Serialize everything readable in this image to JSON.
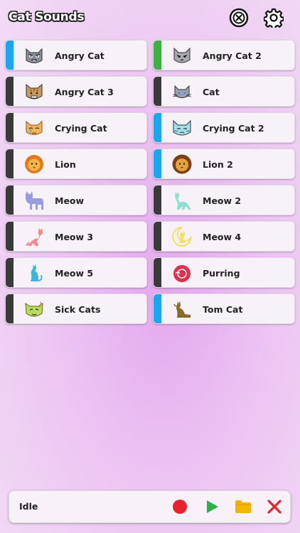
{
  "header": {
    "title": "Cat Sounds",
    "stop_all_icon": "stop-circle-icon",
    "settings_icon": "gear-icon"
  },
  "sounds": [
    {
      "label": "Angry Cat",
      "accent": "#1aa7ec",
      "icon": "angry-cat-face-icon"
    },
    {
      "label": "Angry Cat 2",
      "accent": "#3cb043",
      "icon": "angry-cat-face-2-icon"
    },
    {
      "label": "Angry Cat 3",
      "accent": "#3a3a3a",
      "icon": "tabby-cat-face-icon"
    },
    {
      "label": "Cat",
      "accent": "#3a3a3a",
      "icon": "grey-cat-face-icon"
    },
    {
      "label": "Crying Cat",
      "accent": "#3a3a3a",
      "icon": "crying-cat-face-icon"
    },
    {
      "label": "Crying Cat 2",
      "accent": "#1aa7ec",
      "icon": "crying-cat-face-2-icon"
    },
    {
      "label": "Lion",
      "accent": "#3a3a3a",
      "icon": "lion-face-icon"
    },
    {
      "label": "Lion 2",
      "accent": "#1aa7ec",
      "icon": "lion-face-2-icon"
    },
    {
      "label": "Meow",
      "accent": "#3a3a3a",
      "icon": "cat-silhouette-icon"
    },
    {
      "label": "Meow 2",
      "accent": "#3a3a3a",
      "icon": "cat-silhouette-2-icon"
    },
    {
      "label": "Meow 3",
      "accent": "#3a3a3a",
      "icon": "cat-silhouette-3-icon"
    },
    {
      "label": "Meow 4",
      "accent": "#3a3a3a",
      "icon": "cat-moon-icon"
    },
    {
      "label": "Meow 5",
      "accent": "#3a3a3a",
      "icon": "cat-sitting-icon"
    },
    {
      "label": "Purring",
      "accent": "#3a3a3a",
      "icon": "cat-curled-icon"
    },
    {
      "label": "Sick Cats",
      "accent": "#3a3a3a",
      "icon": "sick-cat-face-icon"
    },
    {
      "label": "Tom Cat",
      "accent": "#1aa7ec",
      "icon": "cat-sitting-brown-icon"
    }
  ],
  "player": {
    "status": "Idle",
    "record_icon": "record-icon",
    "play_icon": "play-icon",
    "folder_icon": "folder-icon",
    "close_icon": "close-icon"
  }
}
